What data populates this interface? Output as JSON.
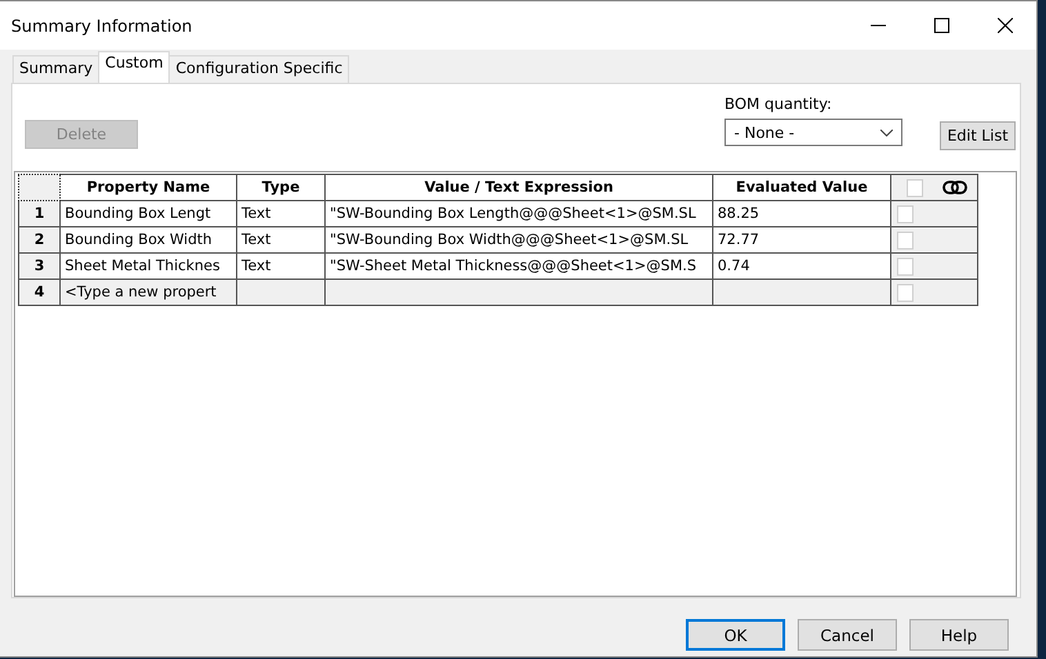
{
  "window": {
    "title": "Summary Information"
  },
  "tabs": [
    {
      "label": "Summary",
      "selected": false
    },
    {
      "label": "Custom",
      "selected": true
    },
    {
      "label": "Configuration Specific",
      "selected": false
    }
  ],
  "delete_button": {
    "label": "Delete",
    "disabled": true
  },
  "bom_quantity": {
    "label": "BOM quantity:",
    "value": "- None -"
  },
  "edit_list_button": {
    "label": "Edit List"
  },
  "table": {
    "columns": [
      "Property Name",
      "Type",
      "Value / Text Expression",
      "Evaluated Value"
    ],
    "header_checked": false,
    "rows": [
      {
        "number": "1",
        "name": "Bounding Box Lengt",
        "type": "Text",
        "value": "\"SW-Bounding Box Length@@@Sheet<1>@SM.SL",
        "evaluated": "88.25",
        "checked": false,
        "kind": "property"
      },
      {
        "number": "2",
        "name": "Bounding Box Width",
        "type": "Text",
        "value": "\"SW-Bounding Box Width@@@Sheet<1>@SM.SL",
        "evaluated": "72.77",
        "checked": false,
        "kind": "property"
      },
      {
        "number": "3",
        "name": "Sheet Metal Thicknes",
        "type": "Text",
        "value": "\"SW-Sheet Metal Thickness@@@Sheet<1>@SM.S",
        "evaluated": "0.74",
        "checked": false,
        "kind": "property"
      },
      {
        "number": "4",
        "name": "<Type a new propert",
        "type": "",
        "value": "",
        "evaluated": "",
        "checked": false,
        "kind": "new"
      }
    ]
  },
  "buttons": [
    {
      "label": "OK",
      "default": true
    },
    {
      "label": "Cancel",
      "default": false
    },
    {
      "label": "Help",
      "default": false
    }
  ]
}
